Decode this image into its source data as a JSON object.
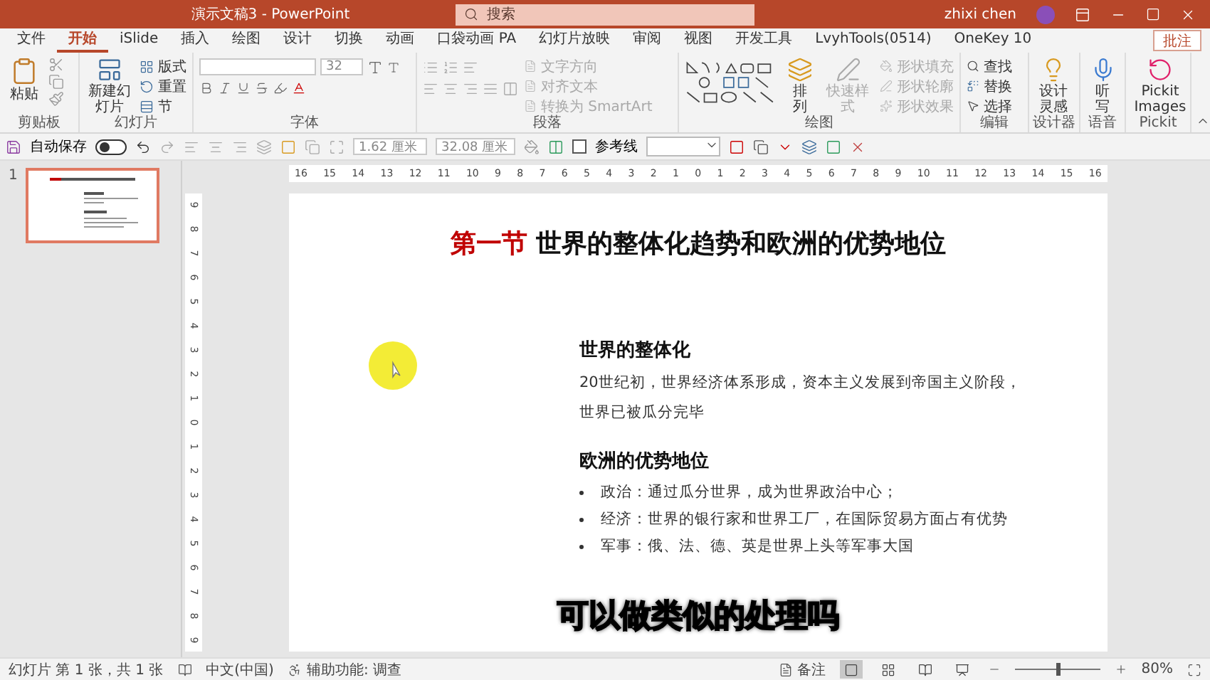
{
  "window": {
    "title": "演示文稿3 - PowerPoint",
    "search_placeholder": "搜索",
    "user": "zhixi chen"
  },
  "tabs": [
    {
      "label": "文件",
      "selected": false
    },
    {
      "label": "开始",
      "selected": true
    },
    {
      "label": "iSlide",
      "selected": false
    },
    {
      "label": "插入",
      "selected": false
    },
    {
      "label": "绘图",
      "selected": false
    },
    {
      "label": "设计",
      "selected": false
    },
    {
      "label": "切换",
      "selected": false
    },
    {
      "label": "动画",
      "selected": false
    },
    {
      "label": "口袋动画 PA",
      "selected": false
    },
    {
      "label": "幻灯片放映",
      "selected": false
    },
    {
      "label": "审阅",
      "selected": false
    },
    {
      "label": "视图",
      "selected": false
    },
    {
      "label": "开发工具",
      "selected": false
    },
    {
      "label": "LvyhTools(0514)",
      "selected": false
    },
    {
      "label": "OneKey 10",
      "selected": false
    }
  ],
  "comments_button": "批注",
  "ribbon": {
    "clipboard": {
      "paste": "粘贴",
      "label": "剪贴板"
    },
    "slides": {
      "new_slide": "新建幻灯片",
      "layout": "版式",
      "reset": "重置",
      "section": "节",
      "label": "幻灯片"
    },
    "font": {
      "size": "32",
      "label": "字体"
    },
    "paragraph": {
      "items": [
        {
          "label": "文字方向",
          "disabled": true
        },
        {
          "label": "对齐文本",
          "disabled": true
        },
        {
          "label": "转换为 SmartArt",
          "disabled": true
        }
      ],
      "label": "段落"
    },
    "drawing": {
      "arrange": "排列",
      "quick_styles": {
        "label": "快速样式",
        "disabled": true
      },
      "items": [
        {
          "label": "形状填充",
          "disabled": true
        },
        {
          "label": "形状轮廓",
          "disabled": true
        },
        {
          "label": "形状效果",
          "disabled": true
        }
      ],
      "label": "绘图"
    },
    "editing": {
      "find": "查找",
      "replace": "替换",
      "select": "选择",
      "label": "编辑"
    },
    "designer": {
      "ideas": "设计灵感",
      "label": "设计器"
    },
    "voice": {
      "dictate": "听写",
      "label": "语音"
    },
    "pickit": {
      "images": "Pickit Images",
      "label": "Pickit"
    }
  },
  "quick_access": {
    "autosave": {
      "label": "自动保存",
      "on": false
    },
    "width": "1.62 厘米",
    "height": "32.08 厘米",
    "guides": {
      "label": "参考线",
      "checked": false
    }
  },
  "ruler": {
    "horizontal": [
      "16",
      "15",
      "14",
      "13",
      "12",
      "11",
      "10",
      "9",
      "8",
      "7",
      "6",
      "5",
      "4",
      "3",
      "2",
      "1",
      "0",
      "1",
      "2",
      "3",
      "4",
      "5",
      "6",
      "7",
      "8",
      "9",
      "10",
      "11",
      "12",
      "13",
      "14",
      "15",
      "16"
    ],
    "vertical": [
      "9",
      "8",
      "7",
      "6",
      "5",
      "4",
      "3",
      "2",
      "1",
      "0",
      "1",
      "2",
      "3",
      "4",
      "5",
      "6",
      "7",
      "8",
      "9"
    ]
  },
  "thumbnails": [
    {
      "number": "1",
      "selected": true
    }
  ],
  "slide": {
    "title_prefix": "第一节",
    "title": "世界的整体化趋势和欧洲的优势地位",
    "sections": [
      {
        "kind": "paragraph",
        "heading": "世界的整体化",
        "lines": [
          "20世纪初，世界经济体系形成，资本主义发展到帝国主义阶段，",
          "世界已被瓜分完毕"
        ]
      },
      {
        "kind": "bullets",
        "heading": "欧洲的优势地位",
        "items": [
          "政治：通过瓜分世界，成为世界政治中心；",
          "经济：世界的银行家和世界工厂，在国际贸易方面占有优势",
          "军事：俄、法、德、英是世界上头等军事大国"
        ]
      }
    ]
  },
  "caption": "可以做类似的处理吗",
  "status_bar": {
    "slide_info": "幻灯片 第 1 张，共 1 张",
    "language": "中文(中国)",
    "accessibility": "辅助功能: 调查",
    "notes": "备注",
    "views": [
      {
        "selected": true
      },
      {
        "selected": false
      },
      {
        "selected": false
      },
      {
        "selected": false
      }
    ],
    "zoom_slider": {
      "level": 0.5
    },
    "zoom": "80%"
  }
}
